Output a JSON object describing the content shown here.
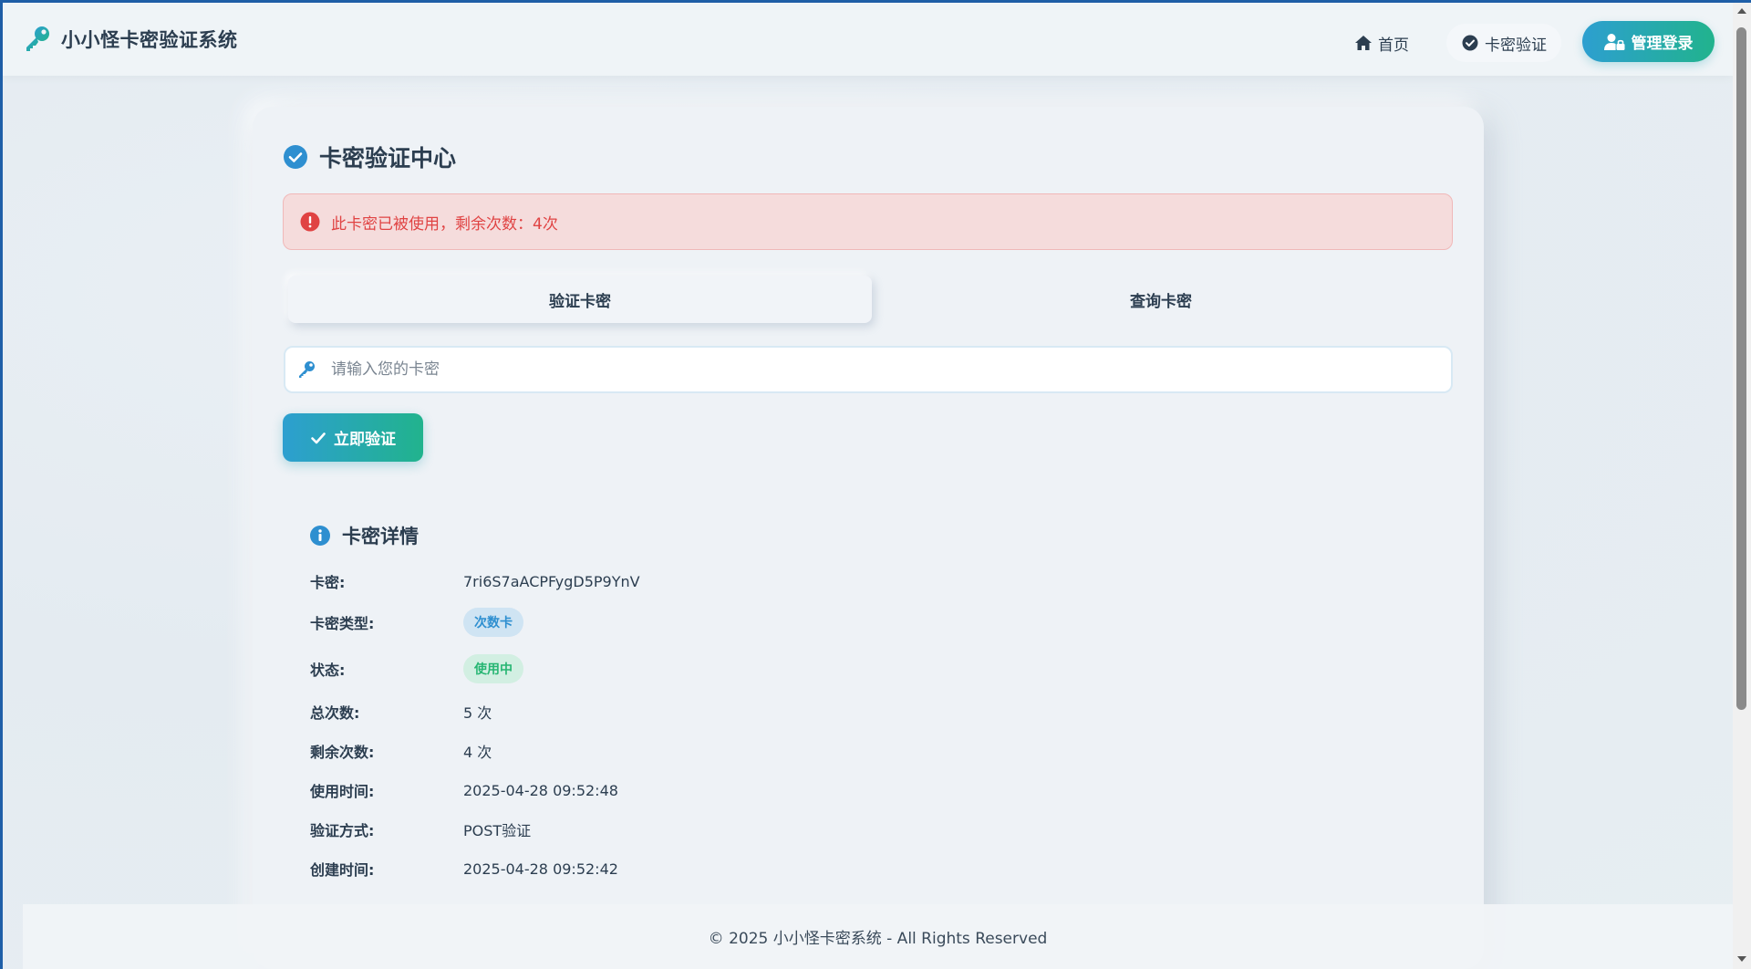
{
  "header": {
    "brand_title": "小小怪卡密验证系统",
    "nav_home": "首页",
    "nav_verify": "卡密验证",
    "admin_login": "管理登录"
  },
  "card": {
    "title": "卡密验证中心",
    "alert": "此卡密已被使用，剩余次数：4次",
    "tabs": [
      {
        "label": "验证卡密",
        "active": true
      },
      {
        "label": "查询卡密",
        "active": false
      }
    ],
    "input": {
      "placeholder": "请输入您的卡密",
      "value": ""
    },
    "verify_button": "立即验证"
  },
  "details": {
    "title": "卡密详情",
    "rows": [
      {
        "label": "卡密:",
        "value": "7ri6S7aACPFygD5P9YnV"
      },
      {
        "label": "卡密类型:",
        "value": "次数卡"
      },
      {
        "label": "状态:",
        "value": "使用中"
      },
      {
        "label": "总次数:",
        "value": "5 次"
      },
      {
        "label": "剩余次数:",
        "value": "4 次"
      },
      {
        "label": "使用时间:",
        "value": "2025-04-28 09:52:48"
      },
      {
        "label": "验证方式:",
        "value": "POST验证"
      },
      {
        "label": "创建时间:",
        "value": "2025-04-28 09:52:42"
      }
    ]
  },
  "footer": {
    "text": "© 2025 小小怪卡密系统 - All Rights Reserved"
  },
  "colors": {
    "accent_gradient_start": "#2d9fd0",
    "accent_gradient_end": "#21b38d",
    "alert_text": "#e04343",
    "alert_bg": "#f5dcdc",
    "type_badge": "#2e8fd0",
    "status_badge": "#27b673"
  },
  "icons": {
    "brand": "key-icon",
    "home": "home-icon",
    "verify": "check-circle-icon",
    "admin": "user-lock-icon",
    "alert": "exclamation-circle-icon",
    "input": "key-icon",
    "button": "check-icon",
    "details": "info-circle-icon"
  }
}
